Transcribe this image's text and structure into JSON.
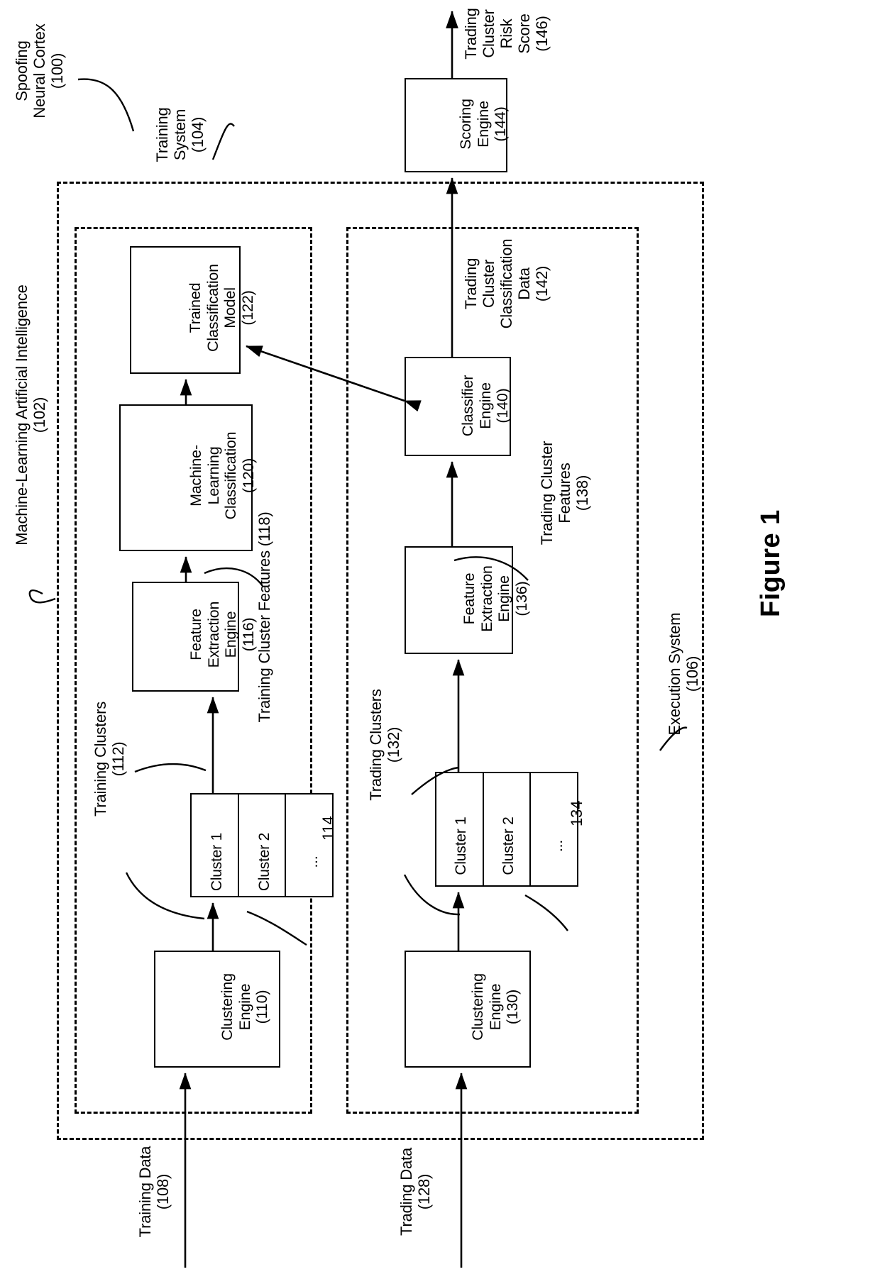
{
  "figure": {
    "caption": "Figure 1"
  },
  "system": {
    "title": "Spoofing\nNeural Cortex\n(100)",
    "ai_boundary_label": "Machine-Learning Artificial Intelligence\n(102)",
    "training_system_label": "Training\nSystem\n(104)",
    "execution_system_label": "Execution System\n(106)"
  },
  "training_branch": {
    "input_label": "Training Data\n(108)",
    "clustering_engine": "Clustering\nEngine\n(110)",
    "clusters_label": "Training Clusters\n(112)",
    "clusters_ref": "114",
    "cluster_cells": [
      "Cluster 1",
      "Cluster 2",
      "..."
    ],
    "feature_extraction_engine": "Feature\nExtraction\nEngine\n(116)",
    "features_label": "Training Cluster Features (118)",
    "ml_classification": "Machine-\nLearning\nClassification\n(120)",
    "trained_model": "Trained\nClassification\nModel\n(122)"
  },
  "execution_branch": {
    "input_label": "Trading Data\n(128)",
    "clustering_engine": "Clustering\nEngine\n(130)",
    "clusters_label": "Trading Clusters\n(132)",
    "clusters_ref": "134",
    "cluster_cells": [
      "Cluster 1",
      "Cluster 2",
      "..."
    ],
    "feature_extraction_engine": "Feature\nExtraction\nEngine\n(136)",
    "features_label": "Trading Cluster\nFeatures\n(138)",
    "classifier_engine": "Classifier\nEngine\n(140)",
    "classification_data_label": "Trading\nCluster\nClassification\nData\n(142)",
    "scoring_engine": "Scoring\nEngine\n(144)",
    "risk_score_label": "Trading\nCluster\nRisk\nScore\n(146)"
  },
  "colors": {
    "stroke": "#000000",
    "background": "#ffffff"
  }
}
